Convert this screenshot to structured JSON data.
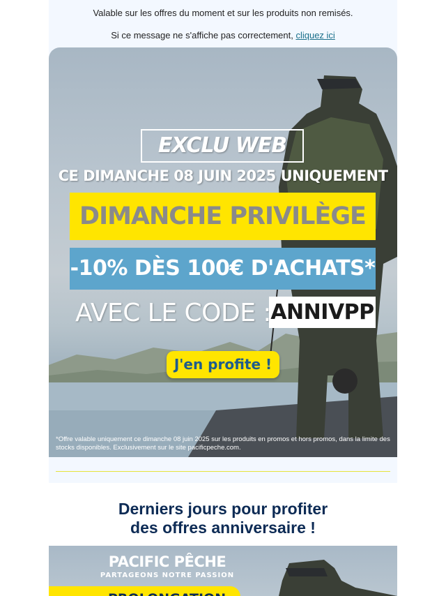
{
  "preheader": {
    "line1": "Valable sur les offres du moment et sur les produits non remisés.",
    "line2_text": "Si ce message ne s'affiche pas correctement, ",
    "line2_link": "cliquez ici"
  },
  "hero": {
    "badge": "EXCLU WEB",
    "date_line": "CE DIMANCHE 08 JUIN 2025 UNIQUEMENT",
    "title": "DIMANCHE PRIVILÈGE",
    "offer": "-10% DÈS 100€ D'ACHATS*",
    "code_label": "AVEC LE CODE :",
    "code": "ANNIVPP",
    "cta": "J'en profite !",
    "disclaimer": "*Offre valable uniquement ce dimanche 08 juin 2025 sur les produits en promos et hors promos, dans la limite des stocks disponibles. Exclusivement sur le site pacificpeche.com."
  },
  "section": {
    "heading_line1": "Derniers jours pour profiter",
    "heading_line2": "des offres anniversaire !"
  },
  "banner2": {
    "brand": "PACIFIC PÊCHE",
    "tagline": "PARTAGEONS NOTRE PASSION",
    "ribbon": "PROLONGATION"
  },
  "colors": {
    "accent_yellow": "#ffe500",
    "accent_blue": "#5da5cc",
    "heading_navy": "#0d2b55",
    "link": "#1a6f8a"
  }
}
